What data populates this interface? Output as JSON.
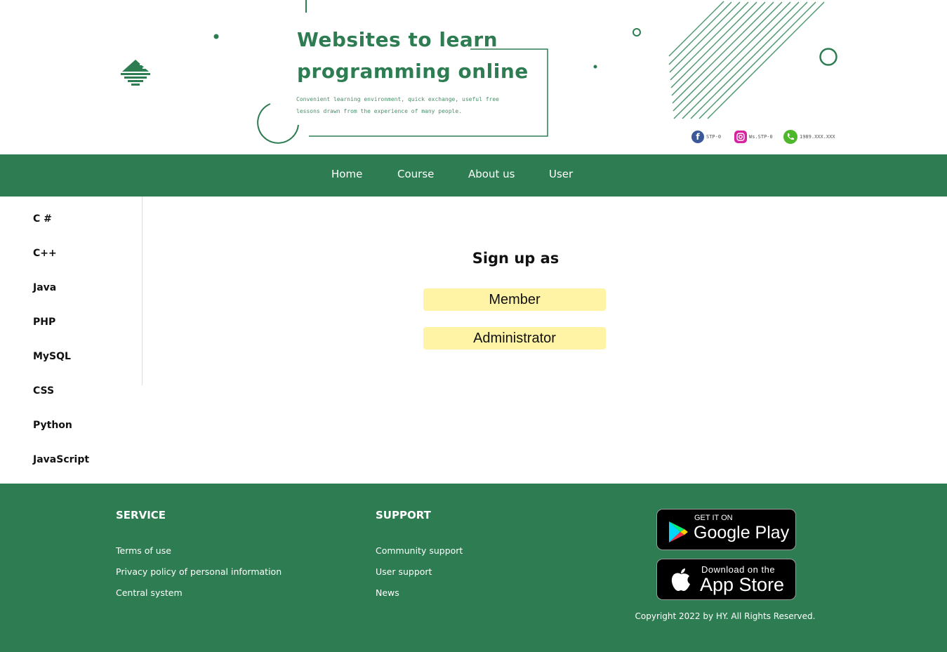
{
  "header": {
    "title_line1": "Websites to learn",
    "title_line2": "programming online",
    "subtitle_line1": "Convenient learning environment, quick exchange, useful free",
    "subtitle_line2": "lessons drawn from the experience of many people.",
    "brand_color": "#2e7d52",
    "social": [
      {
        "icon": "facebook-icon",
        "label": "STP-0",
        "color": "#3b5998"
      },
      {
        "icon": "instagram-icon",
        "label": "Ws.STP-0",
        "color": "#d6249f"
      },
      {
        "icon": "phone-icon",
        "label": "1989.XXX.XXX",
        "color": "#4cb82a"
      }
    ]
  },
  "nav": {
    "items": [
      {
        "label": "Home"
      },
      {
        "label": "Course"
      },
      {
        "label": "About us"
      },
      {
        "label": "User"
      }
    ]
  },
  "sidebar": {
    "items": [
      {
        "label": "C #"
      },
      {
        "label": "C++"
      },
      {
        "label": "Java"
      },
      {
        "label": "PHP"
      },
      {
        "label": "MySQL"
      },
      {
        "label": "CSS"
      },
      {
        "label": "Python"
      },
      {
        "label": "JavaScript"
      }
    ]
  },
  "main": {
    "title": "Sign up as",
    "buttons": [
      {
        "label": "Member"
      },
      {
        "label": "Administrator"
      }
    ],
    "button_color": "#fff3a6"
  },
  "footer": {
    "service": {
      "heading": "SERVICE",
      "links": [
        "Terms of use",
        "Privacy policy of personal information",
        "Central system"
      ]
    },
    "support": {
      "heading": "SUPPORT",
      "links": [
        "Community support",
        "User support",
        "News"
      ]
    },
    "google_play": {
      "small": "GET IT ON",
      "big": "Google Play",
      "icon": "google-play-icon"
    },
    "app_store": {
      "small": "Download on the",
      "big": "App Store",
      "icon": "apple-icon"
    },
    "copyright": "Copyright 2022 by HY. All Rights Reserved."
  }
}
